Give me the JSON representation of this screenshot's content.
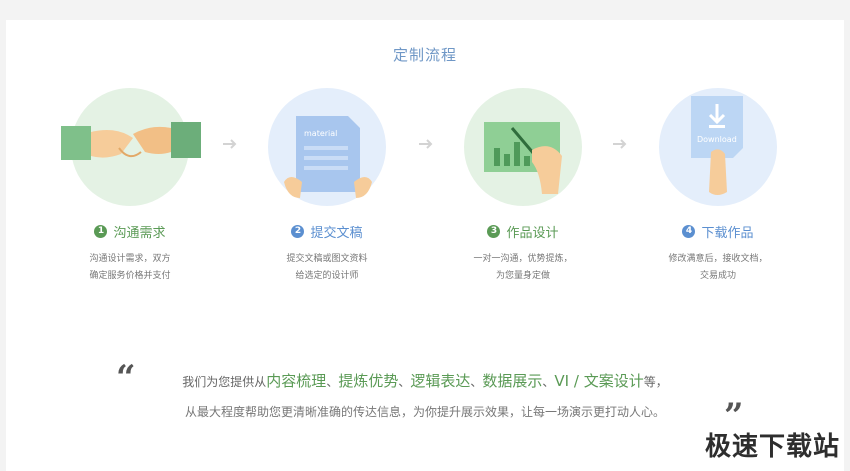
{
  "section": {
    "title": "定制流程"
  },
  "steps": [
    {
      "num": "1",
      "title": "沟通需求",
      "desc1": "沟通设计需求，双方",
      "desc2": "确定服务价格并支付",
      "color": "#5a9a55",
      "bg": "#e4f2e4",
      "icon": "handshake-icon"
    },
    {
      "num": "2",
      "title": "提交文稿",
      "desc1": "提交文稿或图文资料",
      "desc2": "给选定的设计师",
      "color": "#5b8fd0",
      "bg": "#e4eefb",
      "icon": "document-icon",
      "doc_text": "material"
    },
    {
      "num": "3",
      "title": "作品设计",
      "desc1": "一对一沟通，优势提炼，",
      "desc2": "为您量身定做",
      "color": "#5a9a55",
      "bg": "#e4f2e4",
      "icon": "chart-drawing-icon"
    },
    {
      "num": "4",
      "title": "下载作品",
      "desc1": "修改满意后，接收文档，",
      "desc2": "交易成功",
      "color": "#5b8fd0",
      "bg": "#e4eefb",
      "icon": "download-icon",
      "doc_text": "Download"
    }
  ],
  "quote": {
    "p1": "我们为您提供从",
    "h1": "内容梳理",
    "s1": "、",
    "h2": "提炼优势",
    "s2": "、",
    "h3": "逻辑表达",
    "s3": "、",
    "h4": "数据展示",
    "s4": "、",
    "h5": "VI / 文案设计",
    "p2": "等，",
    "line2": "从最大程度帮助您更清晰准确的传达信息，为你提升展示效果，让每一场演示更打动人心。",
    "open_mark": "“",
    "close_mark": "”"
  },
  "watermark": "极速下载站"
}
